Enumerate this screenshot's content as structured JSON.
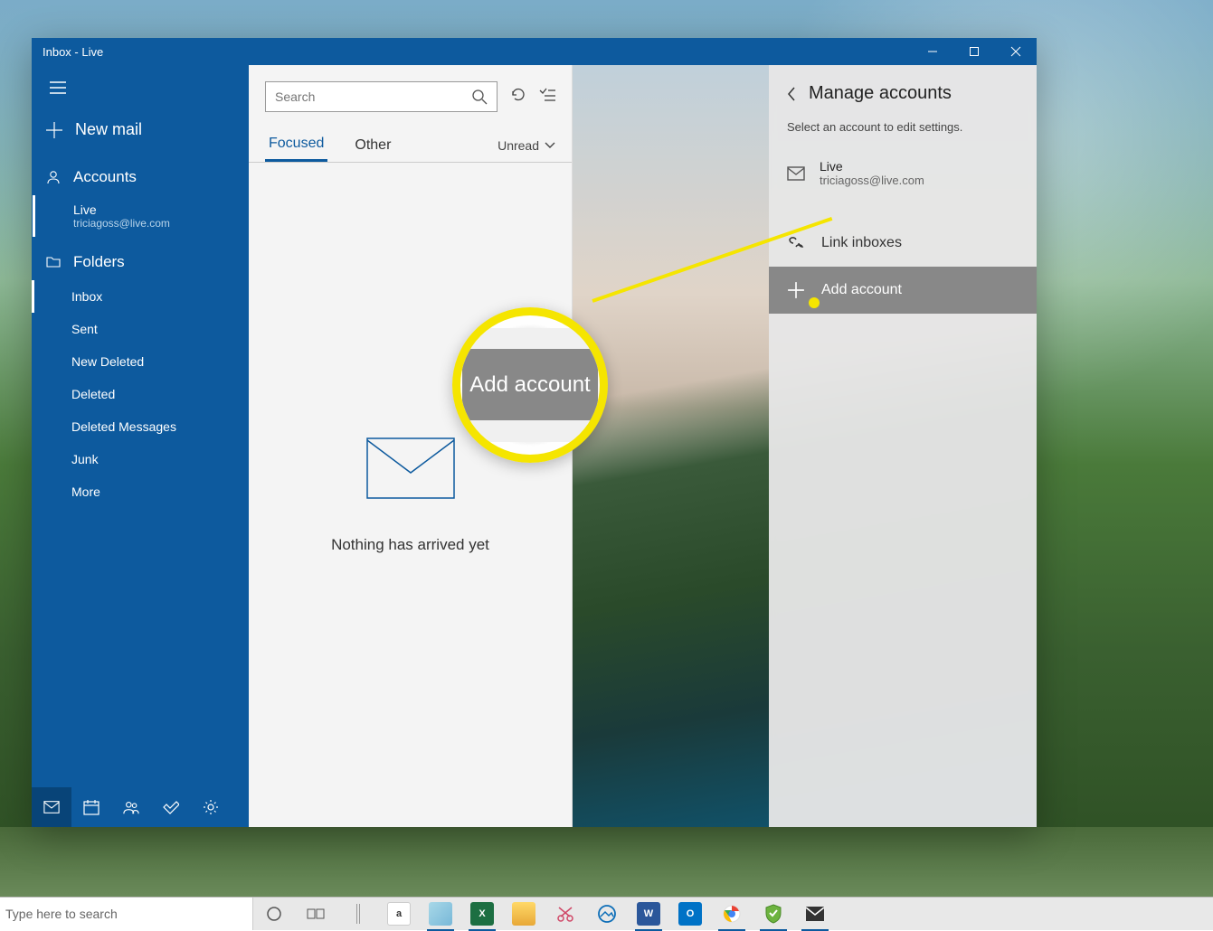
{
  "window_title": "Inbox - Live",
  "sidebar": {
    "new_mail": "New mail",
    "accounts_header": "Accounts",
    "account": {
      "name": "Live",
      "email": "triciagoss@live.com"
    },
    "folders_header": "Folders",
    "folders": [
      "Inbox",
      "Sent",
      "New Deleted",
      "Deleted",
      "Deleted Messages",
      "Junk",
      "More"
    ]
  },
  "messages": {
    "search_placeholder": "Search",
    "tabs": {
      "focused": "Focused",
      "other": "Other"
    },
    "filter": "Unread",
    "empty_text": "Nothing has arrived yet"
  },
  "panel": {
    "title": "Manage accounts",
    "subtitle": "Select an account to edit settings.",
    "account": {
      "name": "Live",
      "email": "triciagoss@live.com"
    },
    "link_inboxes": "Link inboxes",
    "add_account": "Add account"
  },
  "callout_text": "Add account",
  "taskbar": {
    "search_placeholder": "Type here to search"
  }
}
